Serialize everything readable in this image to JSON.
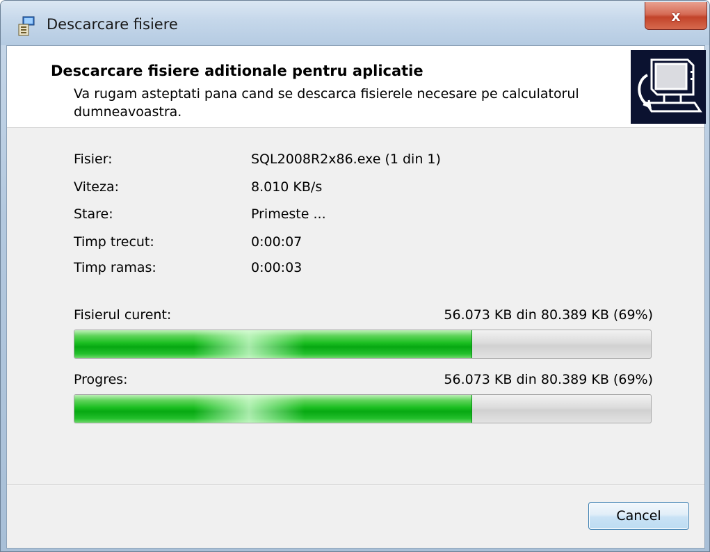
{
  "window": {
    "title": "Descarcare fisiere",
    "close_label": "x"
  },
  "header": {
    "title": "Descarcare fisiere aditionale pentru aplicatie",
    "subtitle": "Va rugam asteptati pana cand se descarca fisierele necesare pe calculatorul dumneavoastra."
  },
  "info": {
    "file_label": "Fisier:",
    "file_value": "SQL2008R2x86.exe (1 din 1)",
    "speed_label": "Viteza:",
    "speed_value": "8.010 KB/s",
    "status_label": "Stare:",
    "status_value": "Primeste ...",
    "elapsed_label": "Timp trecut:",
    "elapsed_value": "0:00:07",
    "remaining_label": "Timp ramas:",
    "remaining_value": "0:00:03"
  },
  "current_file": {
    "label": "Fisierul curent:",
    "detail": "56.073 KB din 80.389 KB (69%)",
    "progress_fraction": 0.69
  },
  "overall": {
    "label": "Progres:",
    "detail": "56.073 KB din 80.389 KB (69%)",
    "progress_fraction": 0.69
  },
  "buttons": {
    "cancel_label": "Cancel"
  },
  "colors": {
    "progress_green": "#1cbf22",
    "close_red": "#c2432a",
    "logo_background": "#0b1230"
  },
  "icons": {
    "app": "installer-icon",
    "logo": "computer-download-icon"
  }
}
